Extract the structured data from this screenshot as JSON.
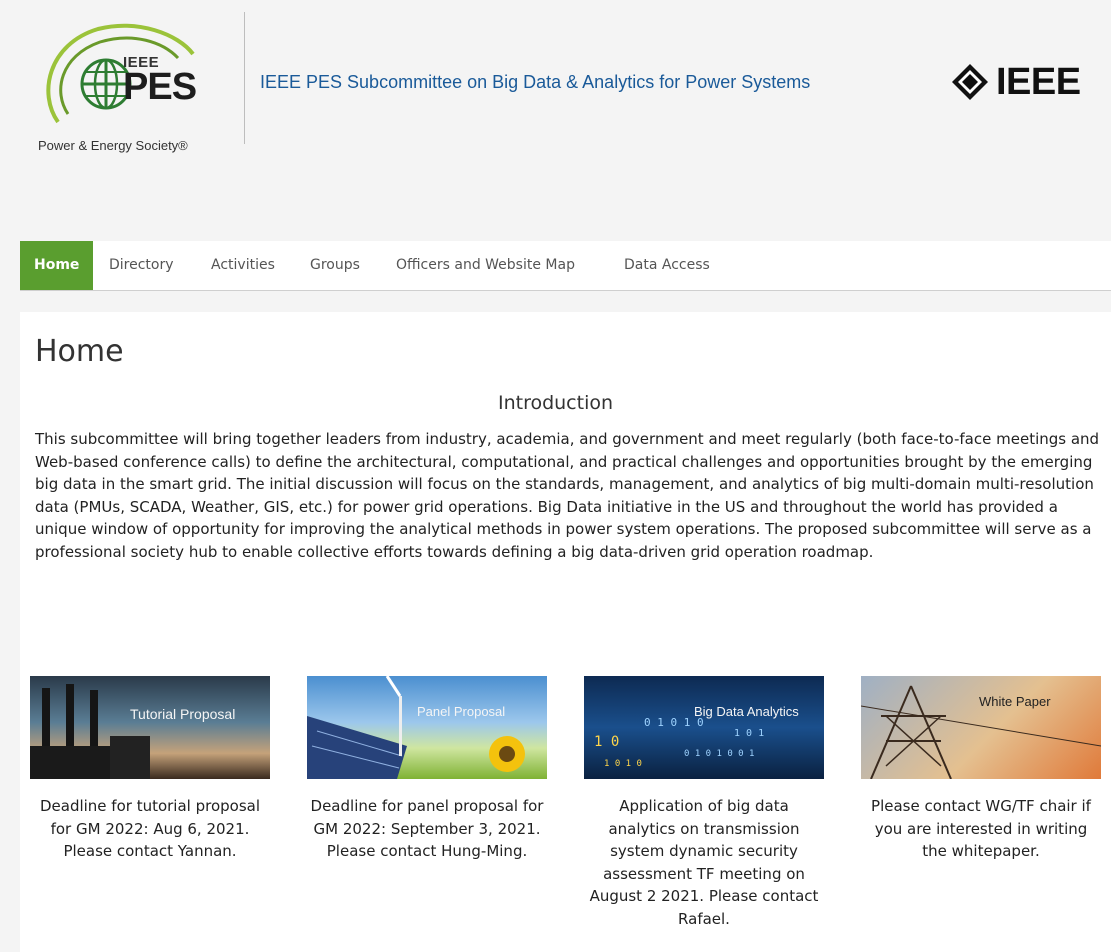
{
  "header": {
    "logo_small": "IEEE",
    "logo_big": "PES",
    "logo_society": "Power & Energy Society®",
    "site_title": "IEEE PES Subcommittee on Big Data & Analytics for Power Systems",
    "ieee_logo": "IEEE"
  },
  "nav": {
    "items": [
      {
        "label": "Home",
        "active": true
      },
      {
        "label": "Directory",
        "active": false
      },
      {
        "label": "Activities",
        "active": false
      },
      {
        "label": "Groups",
        "active": false
      },
      {
        "label": "Officers and Website Map",
        "active": false
      },
      {
        "label": "Data Access",
        "active": false
      }
    ]
  },
  "main": {
    "page_title": "Home",
    "intro_heading": "Introduction",
    "intro_text": "This subcommittee will bring together leaders from industry, academia, and government and meet regularly (both face-to-face meetings and Web-based conference calls) to define the architectural, computational, and practical challenges and opportunities brought by the emerging big data in the smart grid. The initial discussion will focus on the standards, management, and analytics of big multi-domain multi-resolution data (PMUs, SCADA, Weather, GIS, etc.) for power grid operations. Big Data initiative in the US and throughout the world has provided a unique window of opportunity for improving the analytical methods in power system operations. The proposed subcommittee will serve as a professional society hub to enable collective efforts towards defining a big data-driven grid operation roadmap.",
    "cards": [
      {
        "image_label": "Tutorial Proposal",
        "caption": "Deadline for tutorial proposal for GM 2022: Aug 6, 2021. Please contact Yannan."
      },
      {
        "image_label": "Panel Proposal",
        "caption": "Deadline for panel proposal for GM 2022: September 3, 2021. Please contact Hung-Ming."
      },
      {
        "image_label": "Big Data Analytics",
        "caption": "Application of big data analytics on transmission system dynamic security assessment TF meeting on August 2 2021. Please contact Rafael."
      },
      {
        "image_label": "White Paper",
        "caption": "Please contact WG/TF chair if you are interested in writing the whitepaper."
      }
    ]
  },
  "colors": {
    "nav_active": "#5a9e2f",
    "title_blue": "#1a5a99",
    "logo_green": "#6a9a2a"
  }
}
